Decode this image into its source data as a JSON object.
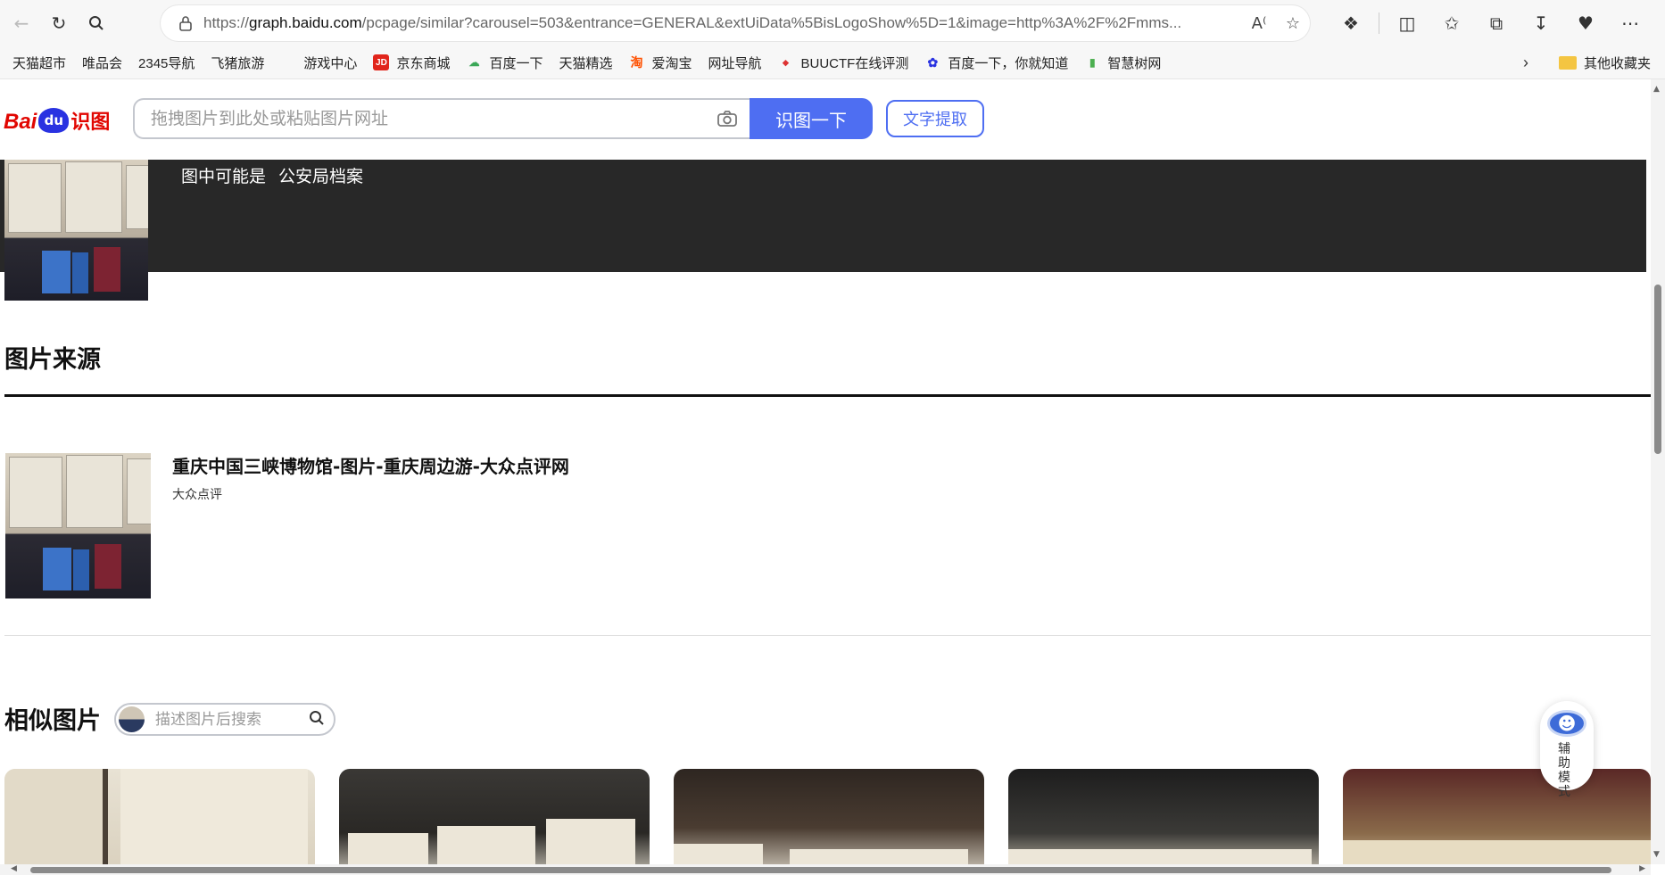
{
  "browser": {
    "url_prefix": "https://",
    "url_host": "graph.baidu.com",
    "url_rest": "/pcpage/similar?carousel=503&entrance=GENERAL&extUiData%5BisLogoShow%5D=1&image=http%3A%2F%2Fmms..."
  },
  "favorites": [
    {
      "label": "天猫超市",
      "icon": "page-icon"
    },
    {
      "label": "唯品会",
      "icon": "page-icon"
    },
    {
      "label": "2345导航",
      "icon": "page-icon"
    },
    {
      "label": "飞猪旅游",
      "icon": "page-icon"
    },
    {
      "label": "游戏中心",
      "icon": "none"
    },
    {
      "label": "京东商城",
      "icon": "jd-icon",
      "glyph": "JD"
    },
    {
      "label": "百度一下",
      "icon": "baidu-cloud-icon"
    },
    {
      "label": "天猫精选",
      "icon": "page-icon"
    },
    {
      "label": "爱淘宝",
      "icon": "taobao-icon",
      "glyph": "淘"
    },
    {
      "label": "网址导航",
      "icon": "page-icon"
    },
    {
      "label": "BUUCTF在线评测",
      "icon": "buuctf-icon"
    },
    {
      "label": "百度一下，你就知道",
      "icon": "baidu-paw-icon"
    },
    {
      "label": "智慧树网",
      "icon": "zhihuishu-icon"
    }
  ],
  "favorites_other": "其他收藏夹",
  "header": {
    "logo_bai": "Bai",
    "logo_du": "du",
    "logo_shitu": "识图",
    "search_placeholder": "拖拽图片到此处或粘贴图片网址",
    "search_button": "识图一下",
    "ocr_button": "文字提取"
  },
  "guess": {
    "prefix": "图中可能是",
    "value": "公安局档案"
  },
  "source_section": {
    "title": "图片来源",
    "item_title": "重庆中国三峡博物馆-图片-重庆周边游-大众点评网",
    "item_site": "大众点评"
  },
  "similar_section": {
    "title": "相似图片",
    "search_placeholder": "描述图片后搜索",
    "cards": 5
  },
  "assist": {
    "label": "辅助模式"
  },
  "colors": {
    "brand_blue": "#4e6ef2",
    "baidu_red": "#e10601",
    "dark_band": "#282828"
  }
}
